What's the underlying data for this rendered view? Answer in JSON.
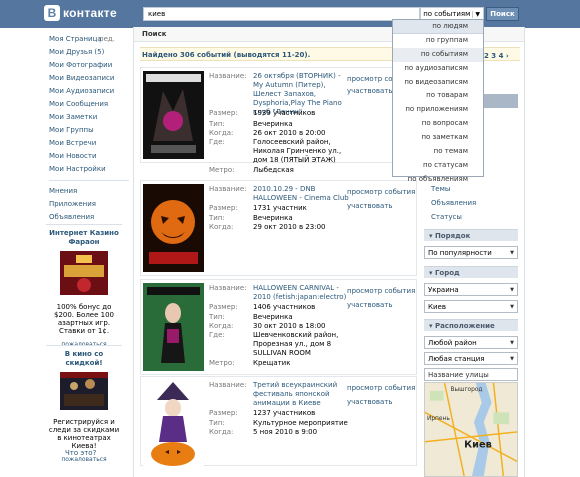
{
  "brand": {
    "logo_letter": "B",
    "name": "контакте"
  },
  "header": {
    "search_value": "киев",
    "search_type": "по событиям",
    "search_button": "Поиск"
  },
  "nav": {
    "items": [
      "Моя Страница",
      "Мои Друзья (5)",
      "Мои Фотографии",
      "Мои Видеозаписи",
      "Мои Аудиозаписи",
      "Мои Сообщения",
      "Мои Заметки",
      "Мои Группы",
      "Мои Встречи",
      "Мои Новости",
      "Мои Настройки"
    ],
    "edit_label": "ред.",
    "extra": [
      "Мнения",
      "Приложения",
      "Объявления"
    ]
  },
  "ads": [
    {
      "title": "Интернет Казино Фараон",
      "text": "100% бонус до $200. Более 100 азартных игр. Ставки от 1¢.",
      "complain": "пожаловаться"
    },
    {
      "title": "В кино со скидкой!",
      "text": "Регистрируйся и следи за скидками в кинотеатрах Киева!",
      "complain": "пожаловаться"
    }
  ],
  "whats_this": "Что это?",
  "main": {
    "tab": "Поиск",
    "found": "Найдено 306 событий (выводятся 11-20).",
    "pages": "2 3 4 ›"
  },
  "dropdown": {
    "options": [
      "по людям",
      "по группам",
      "по событиям",
      "по аудиозаписям",
      "по видеозаписям",
      "по товарам",
      "по приложениям",
      "по вопросам",
      "по заметкам",
      "по темам",
      "по статусам",
      "по объявлениям"
    ],
    "selected": "по событиям"
  },
  "labels": {
    "name": "Название:",
    "size": "Размер:",
    "type": "Тип:",
    "when": "Когда:",
    "where": "Где:",
    "metro": "Метро:",
    "view": "просмотр события",
    "join": "участвовать"
  },
  "events": [
    {
      "name": "26 октября (ВТОРНИК) - My Autumn (Питер), Шелест Запахов, Dysphoria,Play The Piano клуб \"Ленин\"",
      "size": "1939 участников",
      "type": "Вечеринка",
      "when": "26 окт 2010 в 20:00",
      "where": "Голосеевский район, Николая Гринченко ул., дом 18 (ПЯТЫЙ ЭТАЖ)",
      "metro": "Лыбедская"
    },
    {
      "name": "2010.10.29 - DNB HALLOWEEN - Cinema Club",
      "size": "1731 участник",
      "type": "Вечеринка",
      "when": "29 окт 2010 в 23:00"
    },
    {
      "name": "HALLOWEEN CARNIVAL - 2010 (fetish:japan:electro)",
      "size": "1406 участников",
      "type": "Вечеринка",
      "when": "30 окт 2010 в 18:00",
      "where": "Шевченковский район, Прорезная ул., дом 8 SULLIVAN ROOM",
      "metro": "Крещатик"
    },
    {
      "name": "Третий всеукраинский фестиваль японской анимации в Киеве",
      "size": "1237 участников",
      "type": "Культурное мероприятие",
      "when": "5 ноя 2010 в 9:00"
    }
  ],
  "right": {
    "links": [
      "Темы",
      "Объявления",
      "Статусы"
    ],
    "order_title": "Порядок",
    "order_value": "По популярности",
    "city_title": "Город",
    "country": "Украина",
    "city": "Киев",
    "location_title": "Расположение",
    "district": "Любой район",
    "station": "Любая станция",
    "street_placeholder": "Название улицы",
    "map_labels": {
      "city": "Киев",
      "north": "Вышгород",
      "west": "Ирпень"
    }
  }
}
